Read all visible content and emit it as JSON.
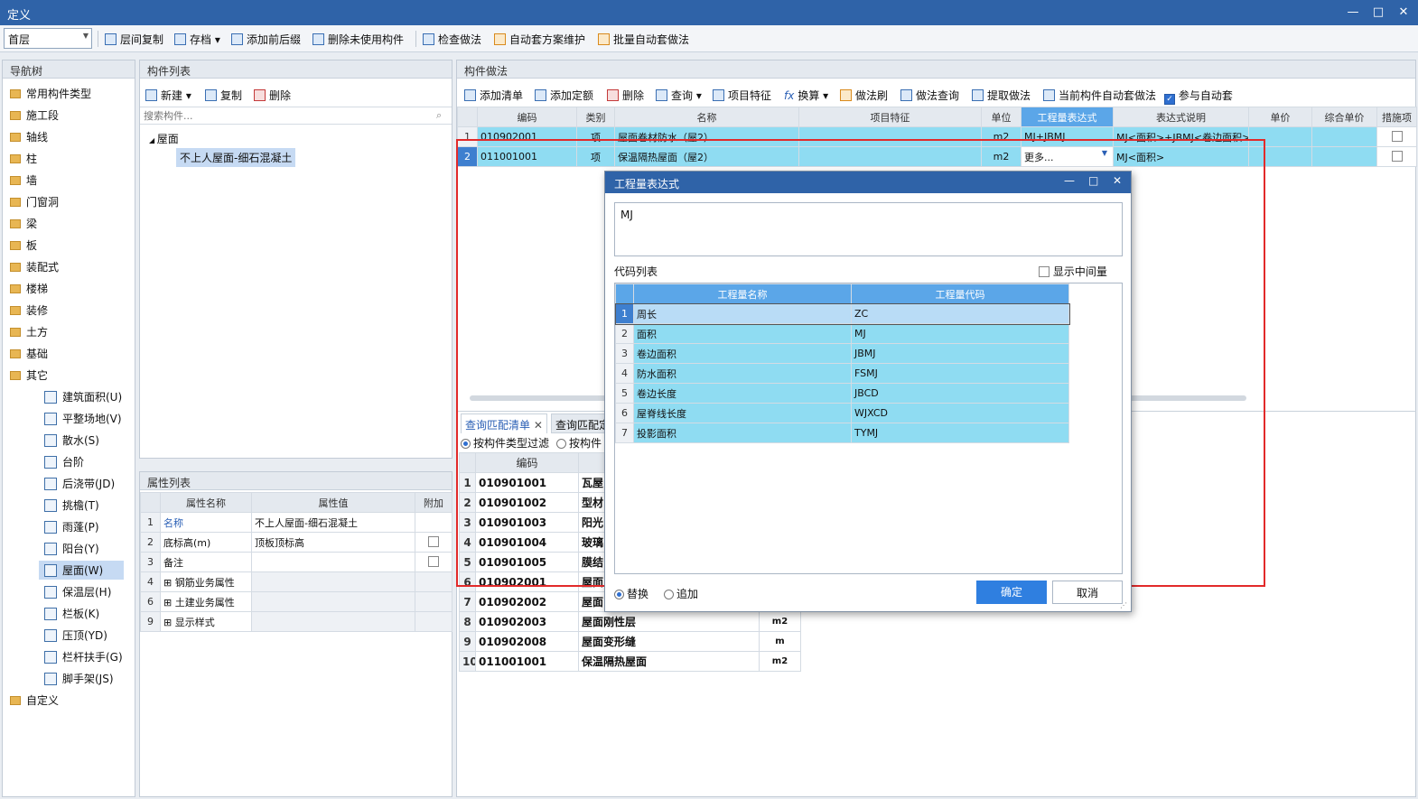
{
  "window": {
    "title": "定义",
    "min": "—",
    "max": "□",
    "close": "✕"
  },
  "toolbar": {
    "floor": "首层",
    "items": [
      "层间复制",
      "存档",
      "添加前后缀",
      "删除未使用构件",
      "检查做法",
      "自动套方案维护",
      "批量自动套做法"
    ]
  },
  "nav": {
    "header": "导航树",
    "folders": [
      "常用构件类型",
      "施工段",
      "轴线",
      "柱",
      "墙",
      "门窗洞",
      "梁",
      "板",
      "装配式",
      "楼梯",
      "装修",
      "土方",
      "基础",
      "其它"
    ],
    "subitems": [
      "建筑面积(U)",
      "平整场地(V)",
      "散水(S)",
      "台阶",
      "后浇带(JD)",
      "挑檐(T)",
      "雨蓬(P)",
      "阳台(Y)",
      "屋面(W)",
      "保温层(H)",
      "栏板(K)",
      "压顶(YD)",
      "栏杆扶手(G)",
      "脚手架(JS)"
    ],
    "custom": "自定义",
    "selected": "屋面(W)"
  },
  "comp": {
    "header": "构件列表",
    "new": "新建",
    "copy": "复制",
    "del": "删除",
    "search_ph": "搜索构件...",
    "tree_root": "屋面",
    "tree_item": "不上人屋面-细石混凝土"
  },
  "props": {
    "header": "属性列表",
    "cols": [
      "属性名称",
      "属性值",
      "附加"
    ],
    "rows": [
      {
        "n": "1",
        "name": "名称",
        "val": "不上人屋面-细石混凝土"
      },
      {
        "n": "2",
        "name": "底标高(m)",
        "val": "顶板顶标高"
      },
      {
        "n": "3",
        "name": "备注",
        "val": ""
      },
      {
        "n": "4",
        "name": "钢筋业务属性",
        "val": ""
      },
      {
        "n": "6",
        "name": "土建业务属性",
        "val": ""
      },
      {
        "n": "9",
        "name": "显示样式",
        "val": ""
      }
    ]
  },
  "method": {
    "header": "构件做法",
    "tools": [
      "添加清单",
      "添加定额",
      "删除",
      "查询",
      "项目特征",
      "换算",
      "做法刷",
      "做法查询",
      "提取做法",
      "当前构件自动套做法",
      "参与自动套"
    ],
    "cols": [
      "编码",
      "类别",
      "名称",
      "项目特征",
      "单位",
      "工程量表达式",
      "表达式说明",
      "单价",
      "综合单价",
      "措施项"
    ],
    "rows": [
      {
        "n": "1",
        "code": "010902001",
        "type": "项",
        "name": "屋面卷材防水（屋2）",
        "unit": "m2",
        "expr": "MJ+JBMJ",
        "desc": "MJ<面积>+JBMJ<卷边面积>"
      },
      {
        "n": "2",
        "code": "011001001",
        "type": "项",
        "name": "保温隔热屋面（屋2）",
        "unit": "m2",
        "expr": "更多...",
        "desc": "MJ<面积>"
      }
    ]
  },
  "lower": {
    "tabs": [
      "查询匹配清单",
      "查询匹配定"
    ],
    "filters": [
      "按构件类型过滤",
      "按构件"
    ],
    "col_code": "编码",
    "rows": [
      {
        "n": "1",
        "code": "010901001",
        "name": "瓦屋",
        "unit": ""
      },
      {
        "n": "2",
        "code": "010901002",
        "name": "型材",
        "unit": ""
      },
      {
        "n": "3",
        "code": "010901003",
        "name": "阳光",
        "unit": ""
      },
      {
        "n": "4",
        "code": "010901004",
        "name": "玻璃",
        "unit": ""
      },
      {
        "n": "5",
        "code": "010901005",
        "name": "膜结",
        "unit": ""
      },
      {
        "n": "6",
        "code": "010902001",
        "name": "屋面",
        "unit": ""
      },
      {
        "n": "7",
        "code": "010902002",
        "name": "屋面",
        "unit": ""
      },
      {
        "n": "8",
        "code": "010902003",
        "name": "屋面刚性层",
        "unit": "m2"
      },
      {
        "n": "9",
        "code": "010902008",
        "name": "屋面变形缝",
        "unit": "m"
      },
      {
        "n": "10",
        "code": "011001001",
        "name": "保温隔热屋面",
        "unit": "m2"
      }
    ]
  },
  "dialog": {
    "title": "工程量表达式",
    "expr": "MJ",
    "code_list": "代码列表",
    "show_mid": "显示中间量",
    "cols": [
      "工程量名称",
      "工程量代码"
    ],
    "rows": [
      {
        "n": "1",
        "name": "周长",
        "code": "ZC"
      },
      {
        "n": "2",
        "name": "面积",
        "code": "MJ"
      },
      {
        "n": "3",
        "name": "卷边面积",
        "code": "JBMJ"
      },
      {
        "n": "4",
        "name": "防水面积",
        "code": "FSMJ"
      },
      {
        "n": "5",
        "name": "卷边长度",
        "code": "JBCD"
      },
      {
        "n": "6",
        "name": "屋脊线长度",
        "code": "WJXCD"
      },
      {
        "n": "7",
        "name": "投影面积",
        "code": "TYMJ"
      }
    ],
    "replace": "替换",
    "append": "追加",
    "ok": "确定",
    "cancel": "取消"
  },
  "colors": {
    "title": "#2f63a8",
    "cyan": "#8fdcf2",
    "sel": "#c6daf3",
    "red": "#e22a2a"
  }
}
